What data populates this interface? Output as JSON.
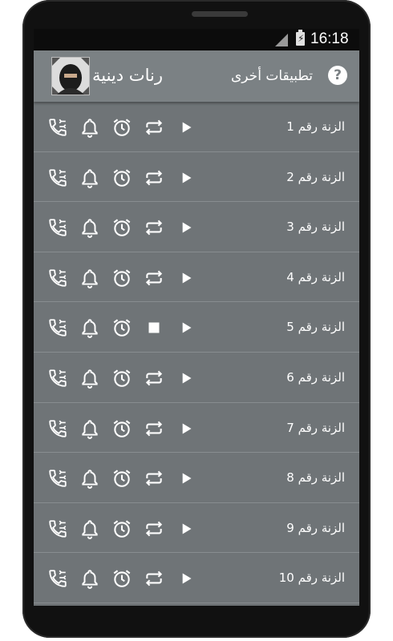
{
  "status_bar": {
    "time": "16:18"
  },
  "action_bar": {
    "title": "رنات دينية",
    "other_apps_label": "تطبيقات أخرى",
    "help_label": "?"
  },
  "ringtones": [
    {
      "label": "الزنة رقم 1",
      "playing": false
    },
    {
      "label": "الزنة رقم 2",
      "playing": false
    },
    {
      "label": "الزنة رقم 3",
      "playing": false
    },
    {
      "label": "الزنة رقم 4",
      "playing": false
    },
    {
      "label": "الزنة رقم 5",
      "playing": true
    },
    {
      "label": "الزنة رقم 6",
      "playing": false
    },
    {
      "label": "الزنة رقم 7",
      "playing": false
    },
    {
      "label": "الزنة رقم 8",
      "playing": false
    },
    {
      "label": "الزنة رقم 9",
      "playing": false
    },
    {
      "label": "الزنة رقم 10",
      "playing": false
    }
  ],
  "icons": {
    "contact_ringtone": "phone-icon",
    "notification": "bell-icon",
    "alarm": "alarm-clock-icon",
    "repeat": "repeat-icon",
    "play": "play-icon",
    "stop": "stop-icon"
  },
  "colors": {
    "screen_bg": "#6f7477",
    "action_bar_bg": "#7b8184",
    "status_bar_bg": "#0c0c0c"
  }
}
